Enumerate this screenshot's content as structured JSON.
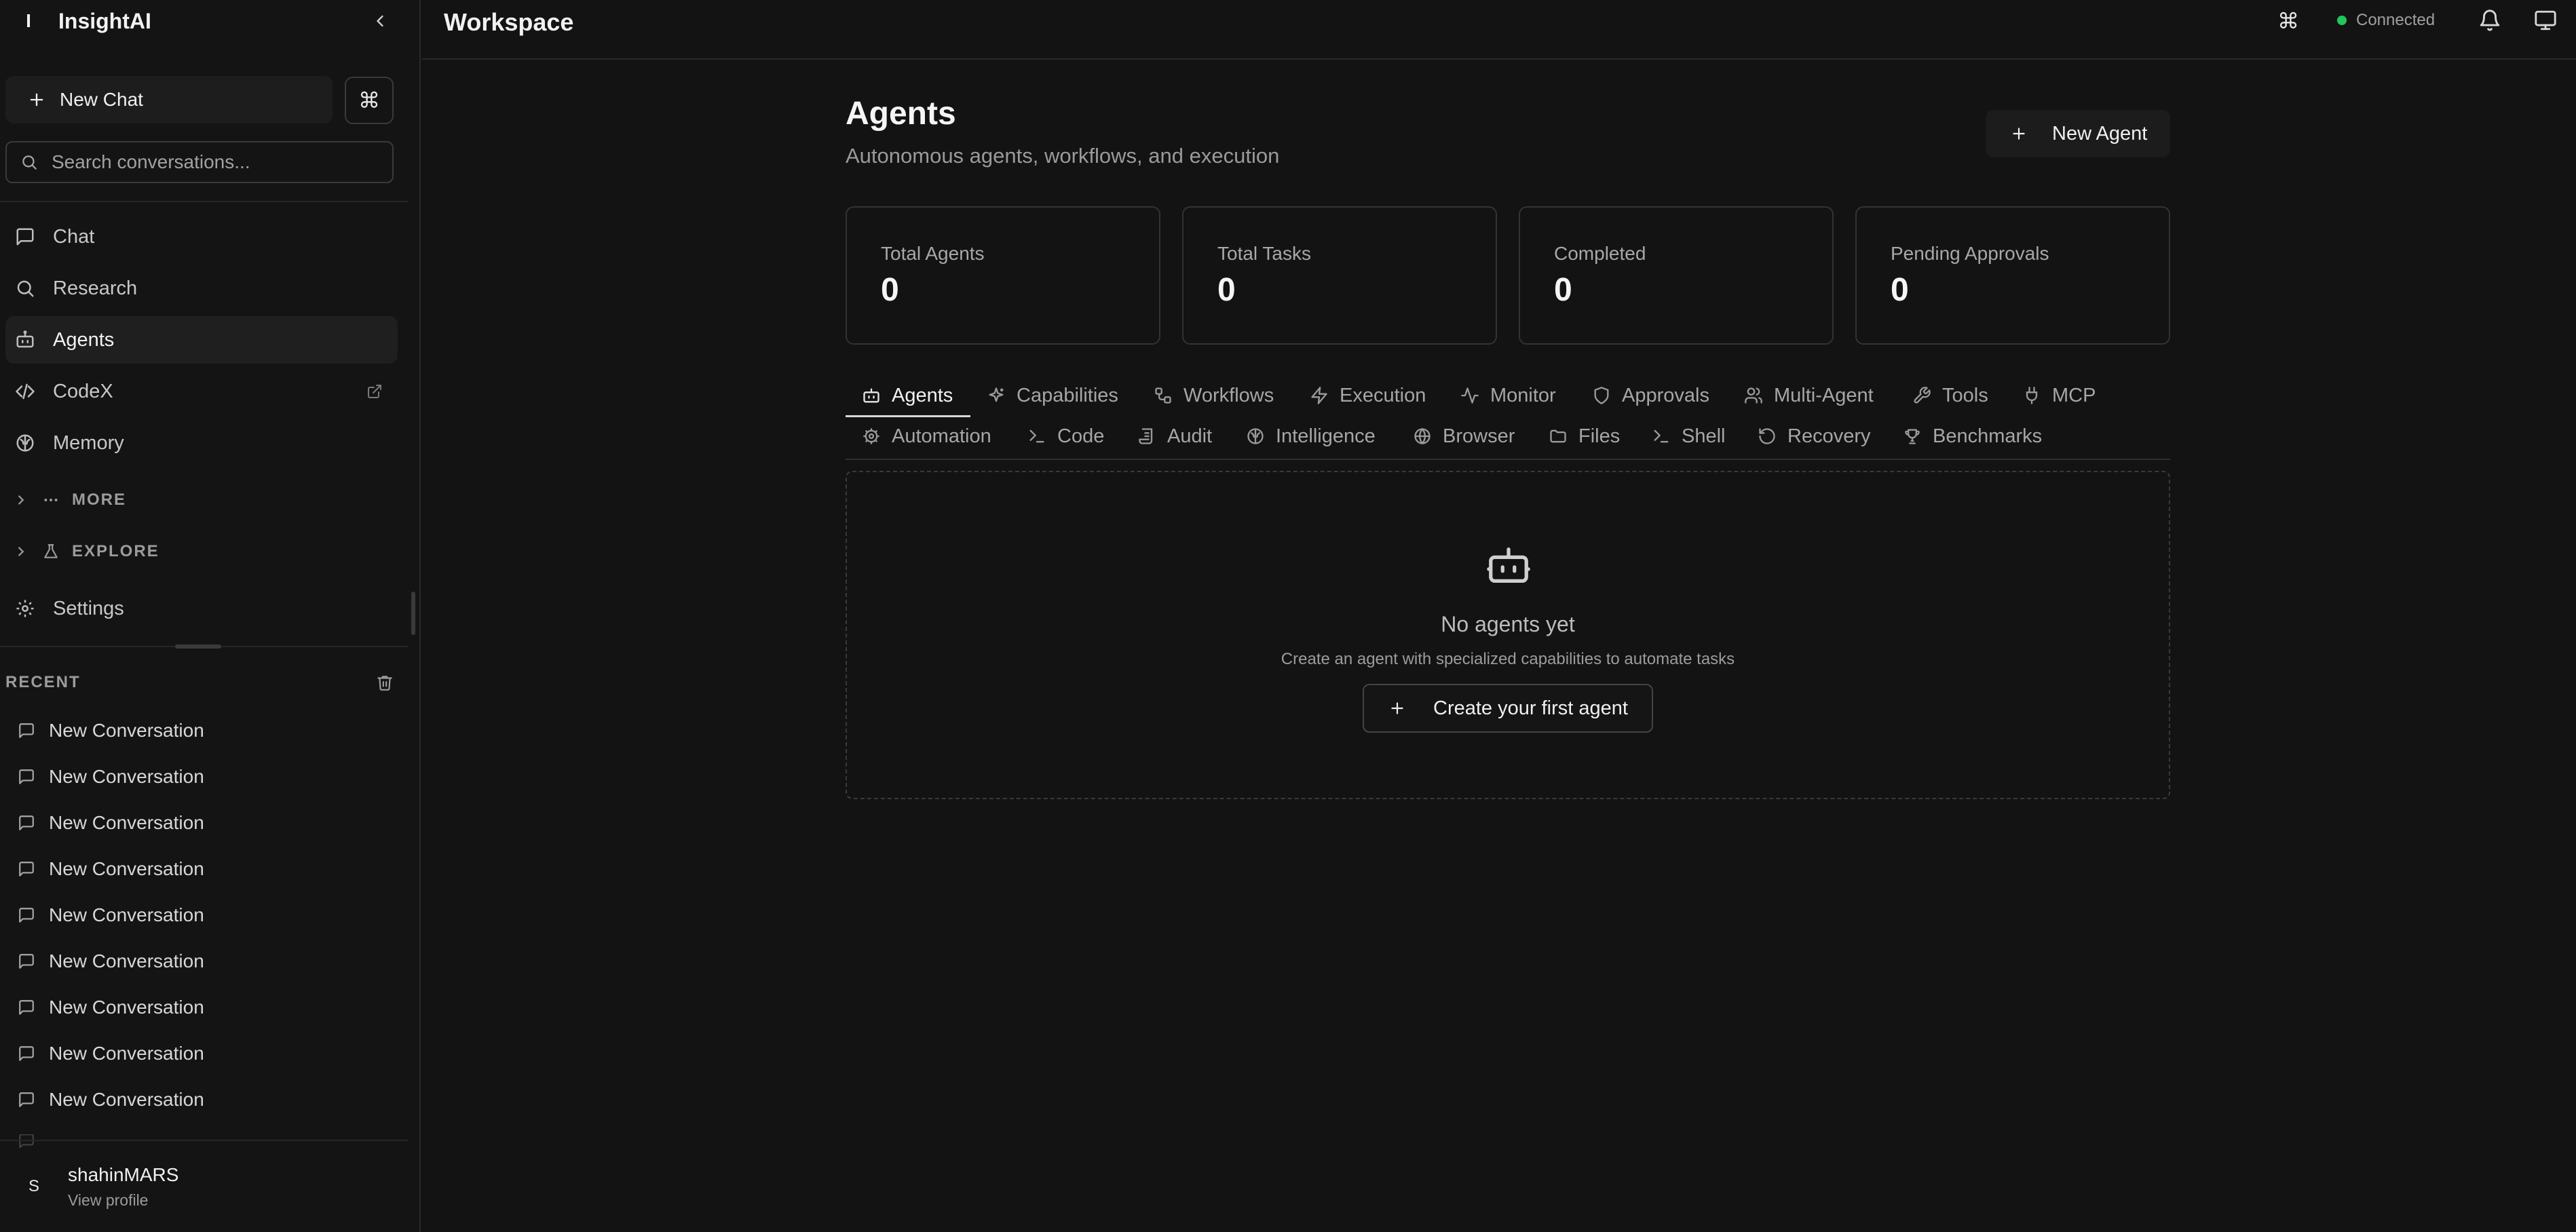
{
  "brand": {
    "mark": "I",
    "name": "InsightAI"
  },
  "sidebar": {
    "new_chat_label": "New Chat",
    "cmd_glyph": "⌘",
    "search_placeholder": "Search conversations...",
    "nav": [
      {
        "label": "Chat",
        "icon": "message-square-icon"
      },
      {
        "label": "Research",
        "icon": "search-icon"
      },
      {
        "label": "Agents",
        "icon": "bot-icon",
        "active": true
      },
      {
        "label": "CodeX",
        "icon": "code-icon",
        "external": true
      },
      {
        "label": "Memory",
        "icon": "brain-icon"
      }
    ],
    "sections": [
      {
        "label": "MORE",
        "icon": "more-dots-icon"
      },
      {
        "label": "EXPLORE",
        "icon": "flask-icon"
      }
    ],
    "settings_label": "Settings",
    "recent_label": "RECENT",
    "recent": [
      "New Conversation",
      "New Conversation",
      "New Conversation",
      "New Conversation",
      "New Conversation",
      "New Conversation",
      "New Conversation",
      "New Conversation",
      "New Conversation"
    ],
    "profile": {
      "initial": "S",
      "name": "shahinMARS",
      "sub": "View profile"
    }
  },
  "topbar": {
    "title": "Workspace",
    "cmd_glyph": "⌘",
    "status": "Connected",
    "status_color": "#22c55e"
  },
  "main": {
    "title": "Agents",
    "subtitle": "Autonomous agents, workflows, and execution",
    "new_agent_label": "New Agent",
    "stats": [
      {
        "label": "Total Agents",
        "value": "0"
      },
      {
        "label": "Total Tasks",
        "value": "0"
      },
      {
        "label": "Completed",
        "value": "0"
      },
      {
        "label": "Pending Approvals",
        "value": "0"
      }
    ],
    "tabs_row1": [
      {
        "label": "Agents",
        "icon": "bot-icon",
        "active": true
      },
      {
        "label": "Capabilities",
        "icon": "sparkles-icon"
      },
      {
        "label": "Workflows",
        "icon": "workflow-icon"
      },
      {
        "label": "Execution",
        "icon": "zap-icon"
      },
      {
        "label": "Monitor",
        "icon": "activity-icon"
      },
      {
        "label": "Approvals",
        "icon": "shield-icon"
      },
      {
        "label": "Multi-Agent",
        "icon": "users-icon"
      },
      {
        "label": "Tools",
        "icon": "wrench-icon"
      },
      {
        "label": "MCP",
        "icon": "plug-icon"
      }
    ],
    "tabs_row2": [
      {
        "label": "Automation",
        "icon": "cog-icon"
      },
      {
        "label": "Code",
        "icon": "terminal-icon"
      },
      {
        "label": "Audit",
        "icon": "scroll-icon"
      },
      {
        "label": "Intelligence",
        "icon": "brain-icon"
      },
      {
        "label": "Browser",
        "icon": "globe-icon"
      },
      {
        "label": "Files",
        "icon": "folder-icon"
      },
      {
        "label": "Shell",
        "icon": "terminal-icon"
      },
      {
        "label": "Recovery",
        "icon": "rotate-icon"
      },
      {
        "label": "Benchmarks",
        "icon": "trophy-icon"
      }
    ],
    "empty": {
      "title": "No agents yet",
      "subtitle": "Create an agent with specialized capabilities to automate tasks",
      "button_label": "Create your first agent"
    }
  }
}
